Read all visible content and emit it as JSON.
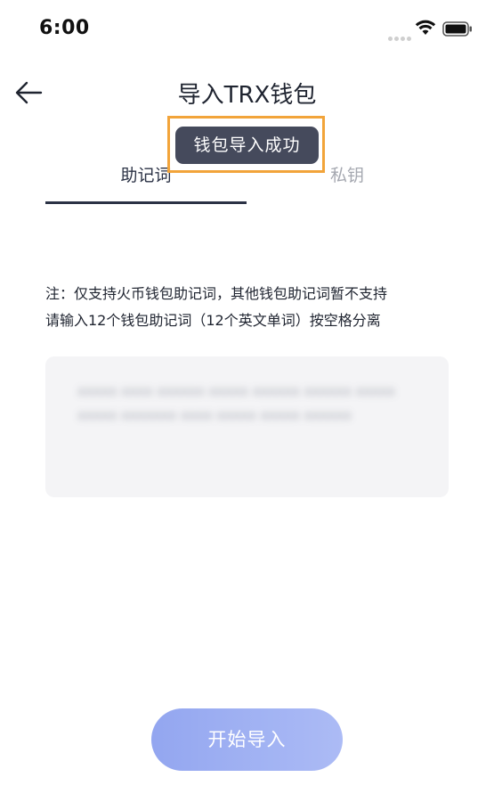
{
  "status_bar": {
    "time": "6:00",
    "signal_icon": "signal-dots-icon",
    "wifi_icon": "wifi-icon",
    "battery_icon": "battery-icon"
  },
  "header": {
    "back_icon": "arrow-left-icon",
    "title": "导入TRX钱包"
  },
  "tabs": [
    {
      "label": "助记词",
      "active": true
    },
    {
      "label": "私钥",
      "active": false
    }
  ],
  "toast": {
    "message": "钱包导入成功",
    "highlight_color": "#f2a43a"
  },
  "notes": {
    "line1": "注：仅支持火币钱包助记词，其他钱包助记词暂不支持",
    "line2": "请输入12个钱包助记词（12个英文单词）按空格分离"
  },
  "mnemonic_input": {
    "value": "xxxxx xxxx xxxxxx xxxxx xxxxxx xxxxxx xxxxx xxxxx xxxxxxx xxxx xxxxx xxxxx xxxxxx"
  },
  "actions": {
    "start_import_label": "开始导入"
  },
  "colors": {
    "primary_dark": "#2b3245",
    "inactive_tab": "#a5a8b0",
    "button_gradient_start": "#8ea2f0",
    "button_gradient_end": "#a8b8f5",
    "input_bg": "#f4f4f6",
    "toast_bg": "#454a5c"
  }
}
